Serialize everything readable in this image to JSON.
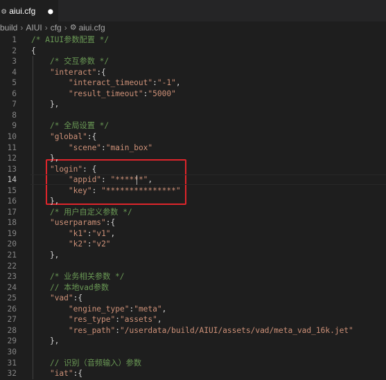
{
  "tab": {
    "filename": "aiui.cfg",
    "icon": "gear-icon",
    "dirty": "●"
  },
  "breadcrumb": [
    "build",
    "AIUI",
    "cfg",
    "aiui.cfg"
  ],
  "colors": {
    "background": "#1e1e1e",
    "comment": "#6a9955",
    "string": "#ce9178",
    "text": "#d4d4d4",
    "line_number": "#858585",
    "highlight_box": "#e0252b"
  },
  "active_line": 14,
  "lines": [
    {
      "n": "1",
      "text": "/* AIUI参数配置 */"
    },
    {
      "n": "2",
      "text": "{"
    },
    {
      "n": "3",
      "text": "    /* 交互参数 */"
    },
    {
      "n": "4",
      "text": "    \"interact\":{"
    },
    {
      "n": "5",
      "text": "        \"interact_timeout\":\"-1\","
    },
    {
      "n": "6",
      "text": "        \"result_timeout\":\"5000\""
    },
    {
      "n": "7",
      "text": "    },"
    },
    {
      "n": "8",
      "text": ""
    },
    {
      "n": "9",
      "text": "    /* 全局设置 */"
    },
    {
      "n": "10",
      "text": "    \"global\":{"
    },
    {
      "n": "11",
      "text": "        \"scene\":\"main_box\""
    },
    {
      "n": "12",
      "text": "    },"
    },
    {
      "n": "13",
      "text": "    \"login\": {"
    },
    {
      "n": "14",
      "text": "        \"appid\": \"******\","
    },
    {
      "n": "15",
      "text": "        \"key\": \"***************\""
    },
    {
      "n": "16",
      "text": "    },"
    },
    {
      "n": "17",
      "text": "    /* 用户自定义参数 */"
    },
    {
      "n": "18",
      "text": "    \"userparams\":{"
    },
    {
      "n": "19",
      "text": "        \"k1\":\"v1\","
    },
    {
      "n": "20",
      "text": "        \"k2\":\"v2\""
    },
    {
      "n": "21",
      "text": "    },"
    },
    {
      "n": "22",
      "text": ""
    },
    {
      "n": "23",
      "text": "    /* 业务相关参数 */"
    },
    {
      "n": "24",
      "text": "    // 本地vad参数"
    },
    {
      "n": "25",
      "text": "    \"vad\":{"
    },
    {
      "n": "26",
      "text": "        \"engine_type\":\"meta\","
    },
    {
      "n": "27",
      "text": "        \"res_type\":\"assets\","
    },
    {
      "n": "28",
      "text": "        \"res_path\":\"/userdata/build/AIUI/assets/vad/meta_vad_16k.jet\""
    },
    {
      "n": "29",
      "text": "    },"
    },
    {
      "n": "30",
      "text": ""
    },
    {
      "n": "31",
      "text": "    // 识别（音频输入）参数"
    },
    {
      "n": "32",
      "text": "    \"iat\":{"
    }
  ]
}
